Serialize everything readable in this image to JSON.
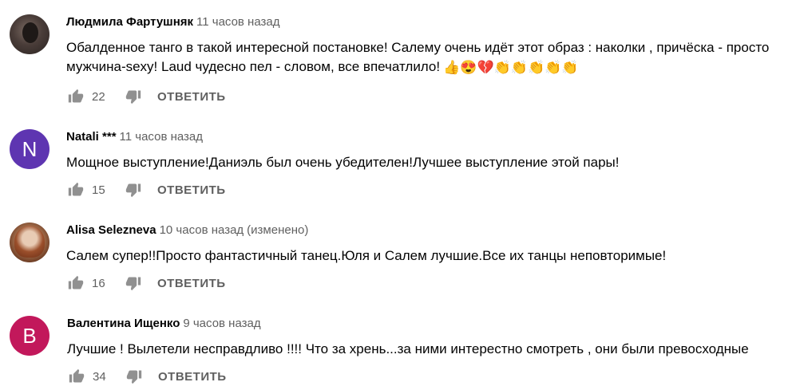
{
  "comments": [
    {
      "author": "Людмила Фартушняк",
      "time": "11 часов назад",
      "edited": "",
      "text_line1": "Обалденное танго в такой интересной постановке! Салему очень идёт этот образ : наколки , причёска - просто",
      "text_line2": "мужчина-sexy!  Laud чудесно пел  - словом, все впечатлило!",
      "emojis": [
        "👍",
        "😍",
        "💔",
        "👏",
        "👏",
        "👏",
        "👏",
        "👏"
      ],
      "likes": "22",
      "reply": "ОТВЕТИТЬ",
      "avatar": "photo"
    },
    {
      "author": "Natali ***",
      "time": "11 часов назад",
      "edited": "",
      "text_line1": "Мощное выступление!Даниэль был очень убедителен!Лучшее выступление этой пары!",
      "likes": "15",
      "reply": "ОТВЕТИТЬ",
      "avatar_letter": "N",
      "avatar_color": "#5e35b1"
    },
    {
      "author": "Alisa Selezneva",
      "time": "10 часов назад",
      "edited": "(изменено)",
      "text_line1": "Салем супер!!Просто фантастичный танец.Юля и Салем лучшие.Все их танцы неповторимые!",
      "likes": "16",
      "reply": "ОТВЕТИТЬ",
      "avatar": "photo"
    },
    {
      "author": "Валентина Ищенко",
      "time": "9 часов назад",
      "edited": "",
      "text_line1": "Лучшие ! Вылетели несправдливо !!!! Что за хрень...за ними интерестно смотреть , они были превосходные",
      "likes": "34",
      "reply": "ОТВЕТИТЬ",
      "avatar_letter": "B",
      "avatar_color": "#c2185b"
    }
  ]
}
